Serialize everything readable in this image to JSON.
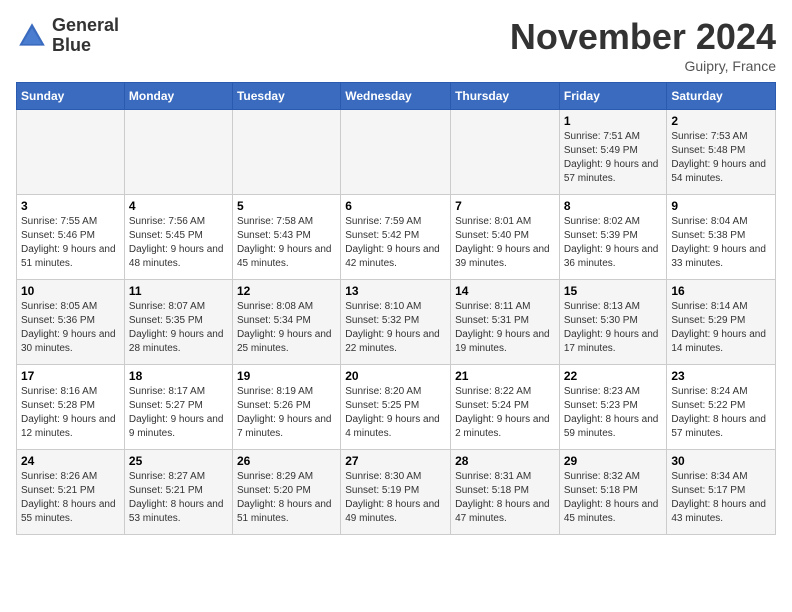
{
  "logo": {
    "line1": "General",
    "line2": "Blue"
  },
  "title": "November 2024",
  "location": "Guipry, France",
  "weekdays": [
    "Sunday",
    "Monday",
    "Tuesday",
    "Wednesday",
    "Thursday",
    "Friday",
    "Saturday"
  ],
  "weeks": [
    [
      {
        "day": "",
        "info": ""
      },
      {
        "day": "",
        "info": ""
      },
      {
        "day": "",
        "info": ""
      },
      {
        "day": "",
        "info": ""
      },
      {
        "day": "",
        "info": ""
      },
      {
        "day": "1",
        "info": "Sunrise: 7:51 AM\nSunset: 5:49 PM\nDaylight: 9 hours and 57 minutes."
      },
      {
        "day": "2",
        "info": "Sunrise: 7:53 AM\nSunset: 5:48 PM\nDaylight: 9 hours and 54 minutes."
      }
    ],
    [
      {
        "day": "3",
        "info": "Sunrise: 7:55 AM\nSunset: 5:46 PM\nDaylight: 9 hours and 51 minutes."
      },
      {
        "day": "4",
        "info": "Sunrise: 7:56 AM\nSunset: 5:45 PM\nDaylight: 9 hours and 48 minutes."
      },
      {
        "day": "5",
        "info": "Sunrise: 7:58 AM\nSunset: 5:43 PM\nDaylight: 9 hours and 45 minutes."
      },
      {
        "day": "6",
        "info": "Sunrise: 7:59 AM\nSunset: 5:42 PM\nDaylight: 9 hours and 42 minutes."
      },
      {
        "day": "7",
        "info": "Sunrise: 8:01 AM\nSunset: 5:40 PM\nDaylight: 9 hours and 39 minutes."
      },
      {
        "day": "8",
        "info": "Sunrise: 8:02 AM\nSunset: 5:39 PM\nDaylight: 9 hours and 36 minutes."
      },
      {
        "day": "9",
        "info": "Sunrise: 8:04 AM\nSunset: 5:38 PM\nDaylight: 9 hours and 33 minutes."
      }
    ],
    [
      {
        "day": "10",
        "info": "Sunrise: 8:05 AM\nSunset: 5:36 PM\nDaylight: 9 hours and 30 minutes."
      },
      {
        "day": "11",
        "info": "Sunrise: 8:07 AM\nSunset: 5:35 PM\nDaylight: 9 hours and 28 minutes."
      },
      {
        "day": "12",
        "info": "Sunrise: 8:08 AM\nSunset: 5:34 PM\nDaylight: 9 hours and 25 minutes."
      },
      {
        "day": "13",
        "info": "Sunrise: 8:10 AM\nSunset: 5:32 PM\nDaylight: 9 hours and 22 minutes."
      },
      {
        "day": "14",
        "info": "Sunrise: 8:11 AM\nSunset: 5:31 PM\nDaylight: 9 hours and 19 minutes."
      },
      {
        "day": "15",
        "info": "Sunrise: 8:13 AM\nSunset: 5:30 PM\nDaylight: 9 hours and 17 minutes."
      },
      {
        "day": "16",
        "info": "Sunrise: 8:14 AM\nSunset: 5:29 PM\nDaylight: 9 hours and 14 minutes."
      }
    ],
    [
      {
        "day": "17",
        "info": "Sunrise: 8:16 AM\nSunset: 5:28 PM\nDaylight: 9 hours and 12 minutes."
      },
      {
        "day": "18",
        "info": "Sunrise: 8:17 AM\nSunset: 5:27 PM\nDaylight: 9 hours and 9 minutes."
      },
      {
        "day": "19",
        "info": "Sunrise: 8:19 AM\nSunset: 5:26 PM\nDaylight: 9 hours and 7 minutes."
      },
      {
        "day": "20",
        "info": "Sunrise: 8:20 AM\nSunset: 5:25 PM\nDaylight: 9 hours and 4 minutes."
      },
      {
        "day": "21",
        "info": "Sunrise: 8:22 AM\nSunset: 5:24 PM\nDaylight: 9 hours and 2 minutes."
      },
      {
        "day": "22",
        "info": "Sunrise: 8:23 AM\nSunset: 5:23 PM\nDaylight: 8 hours and 59 minutes."
      },
      {
        "day": "23",
        "info": "Sunrise: 8:24 AM\nSunset: 5:22 PM\nDaylight: 8 hours and 57 minutes."
      }
    ],
    [
      {
        "day": "24",
        "info": "Sunrise: 8:26 AM\nSunset: 5:21 PM\nDaylight: 8 hours and 55 minutes."
      },
      {
        "day": "25",
        "info": "Sunrise: 8:27 AM\nSunset: 5:21 PM\nDaylight: 8 hours and 53 minutes."
      },
      {
        "day": "26",
        "info": "Sunrise: 8:29 AM\nSunset: 5:20 PM\nDaylight: 8 hours and 51 minutes."
      },
      {
        "day": "27",
        "info": "Sunrise: 8:30 AM\nSunset: 5:19 PM\nDaylight: 8 hours and 49 minutes."
      },
      {
        "day": "28",
        "info": "Sunrise: 8:31 AM\nSunset: 5:18 PM\nDaylight: 8 hours and 47 minutes."
      },
      {
        "day": "29",
        "info": "Sunrise: 8:32 AM\nSunset: 5:18 PM\nDaylight: 8 hours and 45 minutes."
      },
      {
        "day": "30",
        "info": "Sunrise: 8:34 AM\nSunset: 5:17 PM\nDaylight: 8 hours and 43 minutes."
      }
    ]
  ]
}
